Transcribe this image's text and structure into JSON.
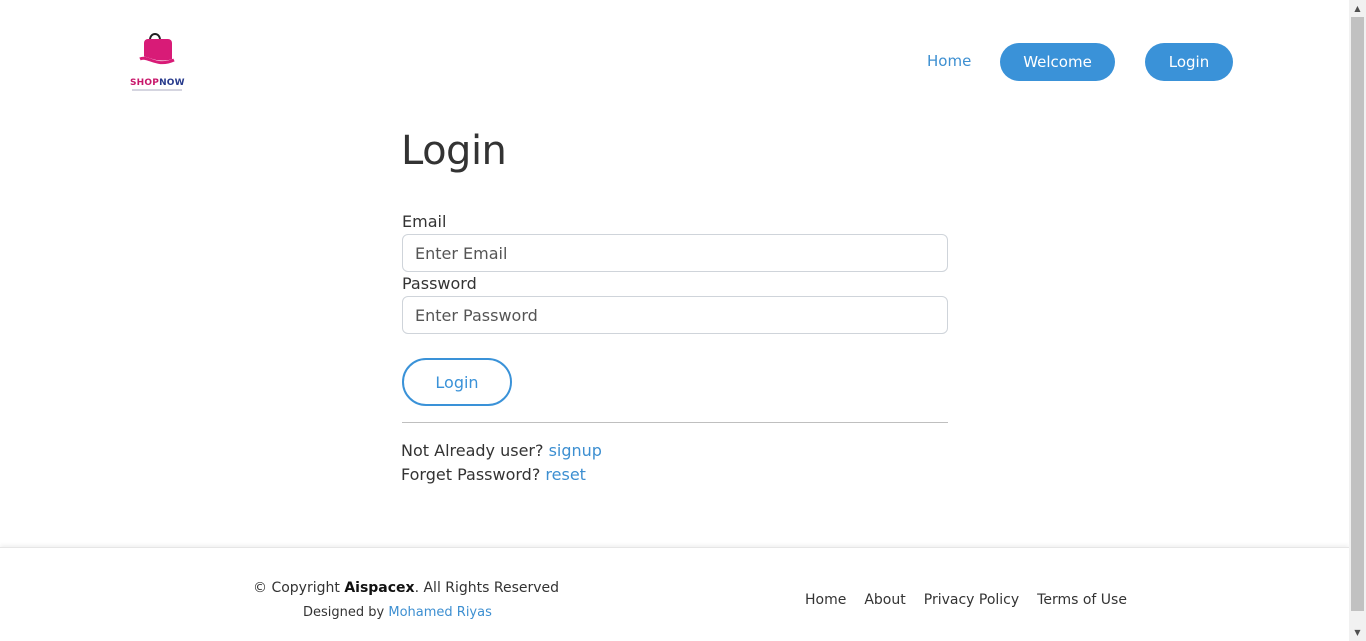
{
  "brand": {
    "name_part1": "SHOP",
    "name_part2": "NOW",
    "logo_icon": "shopping-bag-hand-icon",
    "pink": "#c8176b",
    "navy": "#273a8c"
  },
  "nav": {
    "home": "Home",
    "welcome": "Welcome",
    "login": "Login"
  },
  "form": {
    "title": "Login",
    "email_label": "Email",
    "email_placeholder": "Enter Email",
    "password_label": "Password",
    "password_placeholder": "Enter Password",
    "submit": "Login",
    "signup_text": "Not Already user?",
    "signup_link": "signup",
    "reset_text": "Forget Password?",
    "reset_link": "reset"
  },
  "footer": {
    "copyright_prefix": "© Copyright ",
    "company": "Aispacex",
    "copyright_suffix": ". All Rights Reserved",
    "designed_prefix": "Designed by ",
    "designer": "Mohamed Riyas",
    "links": [
      "Home",
      "About",
      "Privacy Policy",
      "Terms of Use"
    ]
  },
  "colors": {
    "accent": "#3a92d8",
    "link": "#3d8fd1"
  }
}
